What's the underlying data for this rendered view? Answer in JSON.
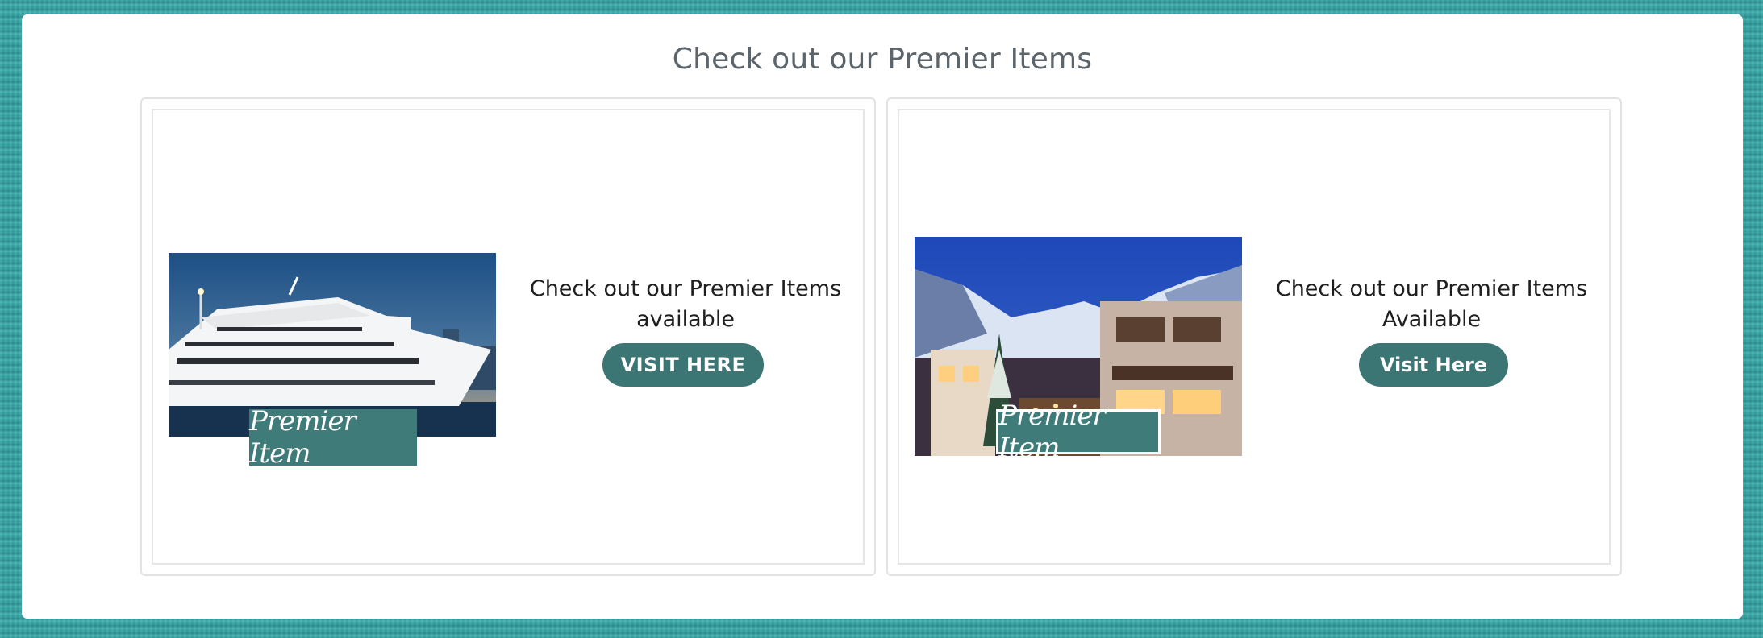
{
  "page": {
    "title": "Check out our Premier Items"
  },
  "cards": [
    {
      "image": {
        "badge_text": "Premier Item",
        "subject": "yacht-on-water"
      },
      "description": "Check out our Premier Items available",
      "button_label": "VISIT HERE"
    },
    {
      "image": {
        "badge_text": "Premier Item",
        "subject": "snowy-mountain-village"
      },
      "description": "Check out our Premier Items Available",
      "button_label": "Visit Here"
    }
  ],
  "colors": {
    "accent": "#3b7674",
    "title_text": "#5c646c",
    "background_teal": "#3aa6a6"
  }
}
